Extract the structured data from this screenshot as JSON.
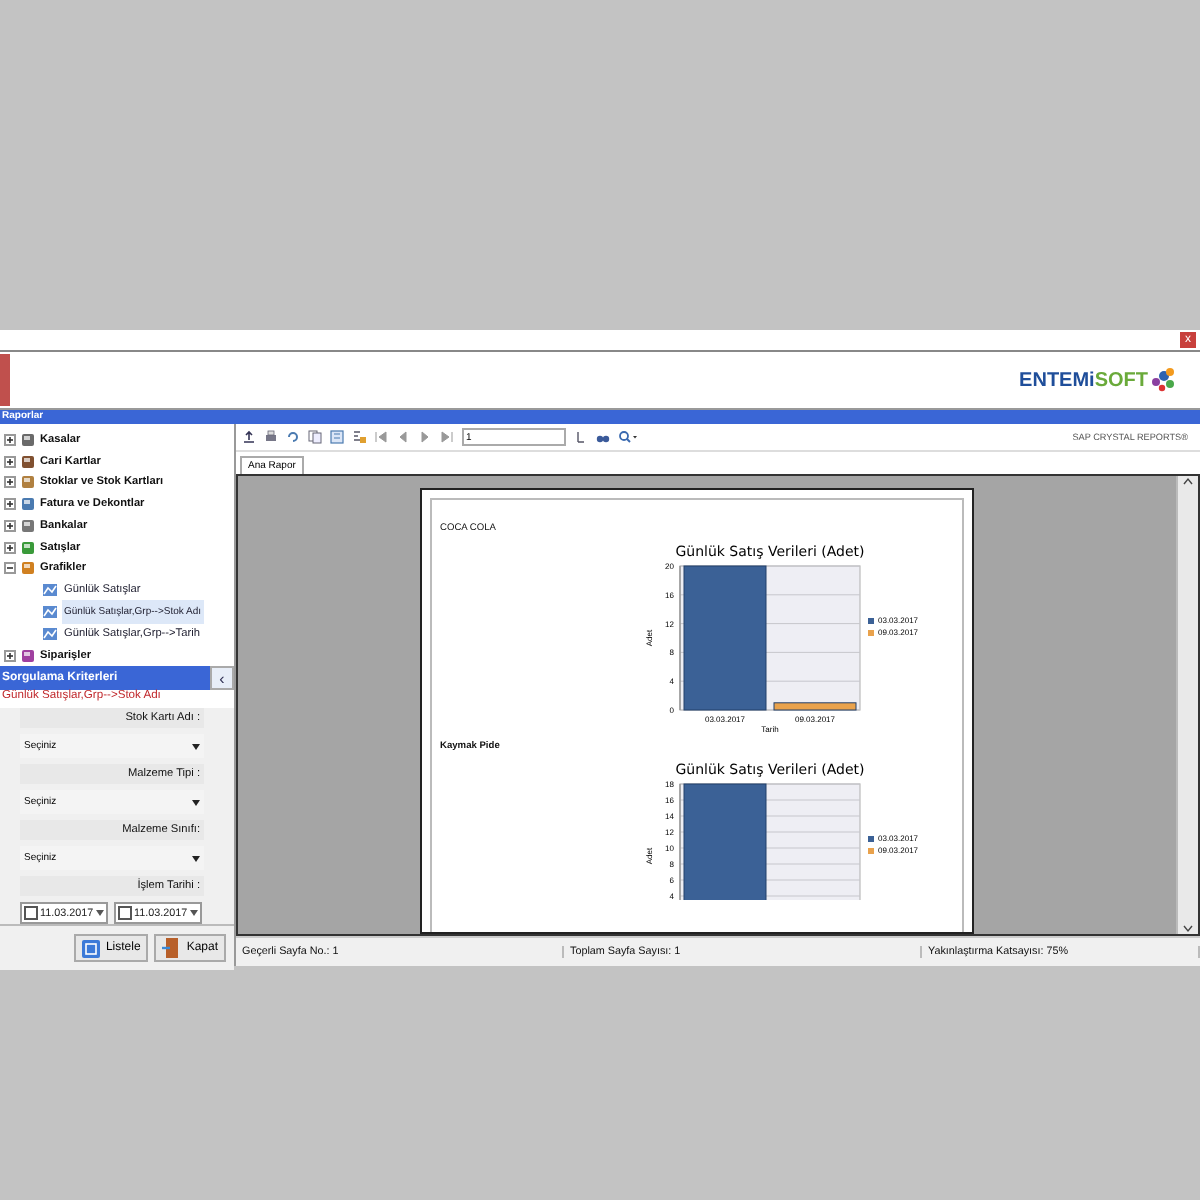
{
  "window": {
    "close_label": "x",
    "logo": {
      "brand_left": "ENTEMi",
      "brand_right": "SOFT"
    }
  },
  "panel_title": "Raporlar",
  "tree": [
    {
      "label": "Kasalar",
      "expanded": false
    },
    {
      "label": "Cari Kartlar",
      "expanded": false
    },
    {
      "label": "Stoklar ve Stok Kartları",
      "expanded": false
    },
    {
      "label": "Fatura ve Dekontlar",
      "expanded": false
    },
    {
      "label": "Bankalar",
      "expanded": false
    },
    {
      "label": "Satışlar",
      "expanded": false
    },
    {
      "label": "Grafikler",
      "expanded": true,
      "children": [
        {
          "label": "Günlük Satışlar",
          "selected": false
        },
        {
          "label": "Günlük Satışlar,Grp-->Stok Adı",
          "selected": true
        },
        {
          "label": "Günlük Satışlar,Grp-->Tarih",
          "selected": false
        }
      ]
    },
    {
      "label": "Siparişler",
      "expanded": false
    }
  ],
  "filter": {
    "title": "Sorgulama Kriterleri",
    "collapse_label": "‹",
    "subtitle": "Günlük Satışlar,Grp-->Stok Adı",
    "fields": [
      {
        "kind": "select",
        "label": "Stok Kartı Adı :",
        "value": "Seçiniz"
      },
      {
        "kind": "select",
        "label": "Malzeme Tipi :",
        "value": "Seçiniz"
      },
      {
        "kind": "select",
        "label": "Malzeme Sınıfı:",
        "value": "Seçiniz"
      },
      {
        "kind": "daterange",
        "label": "İşlem Tarihi :",
        "dates": [
          {
            "value": "11.03.2017",
            "checked": false
          },
          {
            "value": "11.03.2017",
            "checked": false
          }
        ]
      }
    ],
    "buttons": [
      {
        "label": "Listele",
        "kind": "list"
      },
      {
        "label": "Kapat",
        "kind": "close"
      }
    ]
  },
  "viewer": {
    "page_field": "1",
    "brand": "SAP CRYSTAL REPORTS®",
    "tabs": [
      {
        "label": "Ana Rapor",
        "selected": true
      }
    ],
    "sections": [
      {
        "heading": "COCA COLA",
        "chart_data": {
          "type": "bar",
          "title": "Günlük Satış Verileri (Adet)",
          "xlabel": "Tarih",
          "ylabel": "Adet",
          "categories": [
            "03.03.2017",
            "09.03.2017"
          ],
          "series": [
            {
              "name": "03.03.2017",
              "color": "#3b6196",
              "values": [
                20,
                null
              ]
            },
            {
              "name": "09.03.2017",
              "color": "#e9a24c",
              "values": [
                null,
                1
              ]
            }
          ],
          "ylim": [
            0,
            20
          ],
          "yticks": [
            0,
            4,
            8,
            12,
            16,
            20
          ],
          "grid": true,
          "legend": true
        }
      },
      {
        "heading": "Kaymak Pide",
        "chart_data": {
          "type": "bar",
          "title": "Günlük Satış Verileri (Adet)",
          "ylabel": "Adet",
          "series": [
            {
              "name": "03.03.2017",
              "color": "#3b6196",
              "values": [
                18,
                null
              ]
            },
            {
              "name": "09.03.2017",
              "color": "#e9a24c",
              "values": [
                null,
                null
              ]
            }
          ],
          "ylim": [
            0,
            18
          ],
          "yticks": [
            4,
            6,
            8,
            10,
            12,
            14,
            16,
            18
          ],
          "grid": true,
          "legend": true
        }
      }
    ]
  },
  "status_bar": [
    "Geçerli Sayfa No.: 1",
    "Toplam Sayfa Sayısı: 1",
    "Yakınlaştırma Katsayısı: 75%"
  ]
}
